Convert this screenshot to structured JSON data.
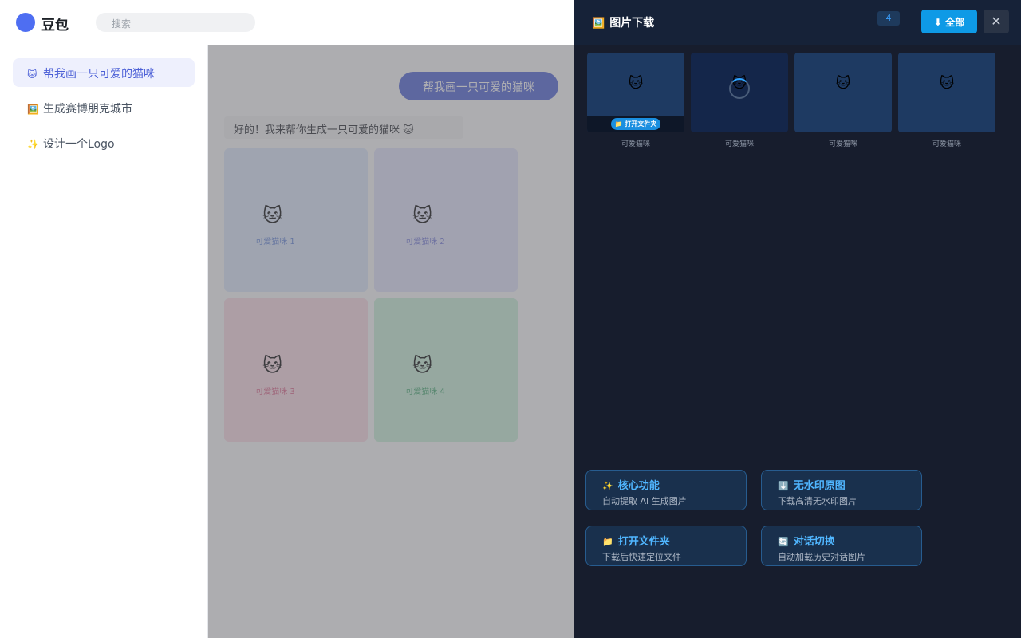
{
  "app": {
    "name": "豆包",
    "search_placeholder": "搜索"
  },
  "sidebar": {
    "items": [
      {
        "icon": "🐱",
        "label": "帮我画一只可爱的猫咪",
        "active": true
      },
      {
        "icon": "🖼️",
        "label": "生成赛博朋克城市",
        "active": false
      },
      {
        "icon": "✨",
        "label": "设计一个Logo",
        "active": false
      }
    ]
  },
  "chat": {
    "user_message": "帮我画一只可爱的猫咪",
    "bot_message": "好的！我来帮你生成一只可爱的猫咪 🐱",
    "images": [
      {
        "emoji": "🐱",
        "caption": "可爱猫咪 1",
        "bg": "#dbe7fb",
        "color": "#5b7fd6"
      },
      {
        "emoji": "🐱",
        "caption": "可爱猫咪 2",
        "bg": "#e1e3fb",
        "color": "#6b72d6"
      },
      {
        "emoji": "🐱",
        "caption": "可爱猫咪 3",
        "bg": "#fbd9e3",
        "color": "#d95b82"
      },
      {
        "emoji": "🐱",
        "caption": "可爱猫咪 4",
        "bg": "#c8f0d8",
        "color": "#3aa468"
      }
    ]
  },
  "panel": {
    "title_icon": "🖼️",
    "title": "图片下载",
    "count": "4",
    "download_all": "⬇ 全部",
    "close": "✕",
    "thumbs": [
      {
        "emoji": "🐱",
        "caption": "可爱猫咪",
        "state": "ready",
        "open_folder": "📁 打开文件夹"
      },
      {
        "emoji": "🐱",
        "caption": "可爱猫咪",
        "state": "loading"
      },
      {
        "emoji": "🐱",
        "caption": "可爱猫咪",
        "state": "ready"
      },
      {
        "emoji": "🐱",
        "caption": "可爱猫咪",
        "state": "ready"
      }
    ],
    "features": [
      {
        "icon": "✨",
        "title": "核心功能",
        "desc": "自动提取 AI 生成图片"
      },
      {
        "icon": "⬇️",
        "title": "无水印原图",
        "desc": "下载高清无水印图片"
      },
      {
        "icon": "📁",
        "title": "打开文件夹",
        "desc": "下载后快速定位文件"
      },
      {
        "icon": "🔄",
        "title": "对话切换",
        "desc": "自动加载历史对话图片"
      }
    ]
  },
  "colors": {
    "accent": "#4b5fd6",
    "panel_bg": "#171d2d",
    "panel_accent": "#0e9ae6"
  }
}
